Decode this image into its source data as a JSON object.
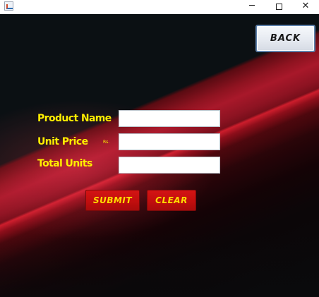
{
  "window": {
    "icon": "java-app-icon",
    "controls": {
      "minimize": "─",
      "close": "✕"
    }
  },
  "header": {
    "back_label": "BACK"
  },
  "form": {
    "fields": [
      {
        "label": "Product Name",
        "value": "",
        "placeholder": ""
      },
      {
        "label": "Unit Price",
        "value": "",
        "placeholder": "",
        "currency": "Rs."
      },
      {
        "label": "Total Units",
        "value": "",
        "placeholder": ""
      }
    ],
    "submit_label": "SUBMIT",
    "clear_label": "CLEAR"
  },
  "colors": {
    "background": "#0b1013",
    "accent_red": "#c10e0e",
    "label_yellow": "#ffee00",
    "button_text": "#ffdc00"
  }
}
